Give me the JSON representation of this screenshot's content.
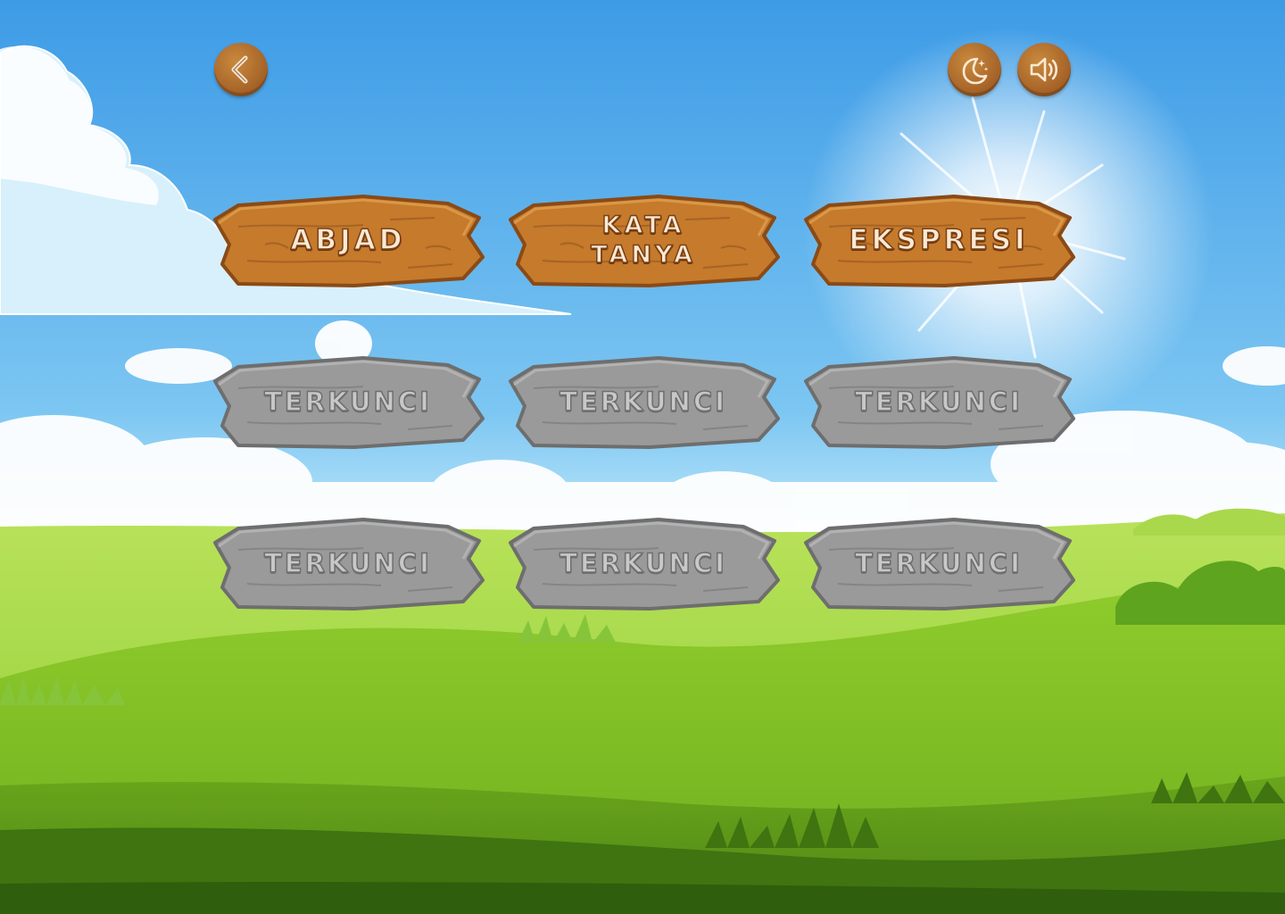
{
  "colors": {
    "sky_top": "#4aa6ea",
    "sky_bottom": "#bfe8fb",
    "grass_light": "#9fd640",
    "grass_dark": "#4f8a1a",
    "wood": "#c57a2c",
    "stone": "#9a9a9a"
  },
  "header": {
    "back_icon": "chevron-left-icon",
    "theme_icon": "moon-stars-icon",
    "sound_icon": "speaker-icon"
  },
  "levels": [
    {
      "label": "ABJAD",
      "state": "unlocked"
    },
    {
      "label": "KATA\nTANYA",
      "state": "unlocked"
    },
    {
      "label": "EKSPRESI",
      "state": "unlocked"
    },
    {
      "label": "TERKUNCI",
      "state": "locked"
    },
    {
      "label": "TERKUNCI",
      "state": "locked"
    },
    {
      "label": "TERKUNCI",
      "state": "locked"
    },
    {
      "label": "TERKUNCI",
      "state": "locked"
    },
    {
      "label": "TERKUNCI",
      "state": "locked"
    },
    {
      "label": "TERKUNCI",
      "state": "locked"
    }
  ]
}
